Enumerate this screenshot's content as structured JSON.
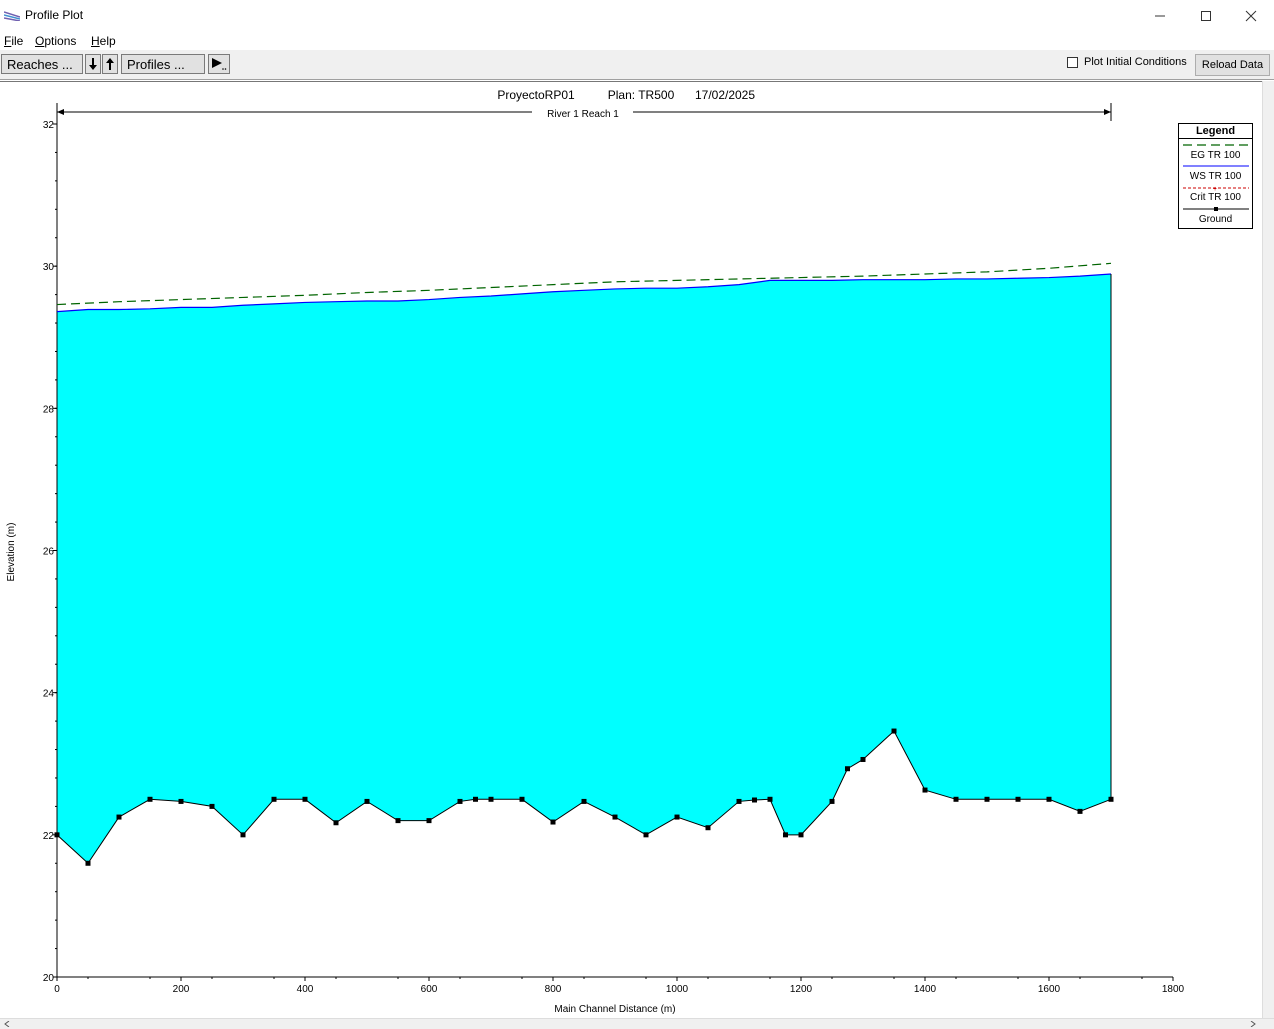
{
  "window": {
    "title": "Profile Plot",
    "minimize_glyph": "—",
    "maximize_glyph": "☐",
    "close_glyph": "✕"
  },
  "menu": {
    "file": {
      "accel": "F",
      "rest": "ile"
    },
    "options": {
      "accel": "O",
      "rest": "ptions"
    },
    "help": {
      "accel": "H",
      "rest": "elp"
    }
  },
  "toolbar": {
    "reaches_label": "Reaches ...",
    "profiles_label": "Profiles ...",
    "down_glyph": "🠗",
    "up_glyph": "🠕",
    "play_glyph": "▶",
    "plot_initial_label": "Plot Initial Conditions",
    "plot_initial_checked": false,
    "reload_label": "Reload Data"
  },
  "plot": {
    "project": "ProyectoRP01",
    "plan": "Plan: TR500",
    "date": "17/02/2025",
    "reach_label": "River 1 Reach 1",
    "legend": {
      "title": "Legend",
      "items": [
        "EG  TR 100",
        "WS  TR 100",
        "Crit  TR 100",
        "Ground"
      ]
    },
    "colors": {
      "water": "#00ffff",
      "ws_line": "#0000ff",
      "eg_line": "#006400",
      "crit_line": "#cc0000",
      "ground": "#000000"
    }
  },
  "chart_data": {
    "type": "line",
    "xlabel": "Main Channel Distance (m)",
    "ylabel": "Elevation (m)",
    "xlim": [
      0,
      1800
    ],
    "ylim": [
      20,
      32
    ],
    "xticks": [
      0,
      200,
      400,
      600,
      800,
      1000,
      1200,
      1400,
      1600,
      1800
    ],
    "yticks": [
      20,
      22,
      24,
      26,
      28,
      30,
      32
    ],
    "series": [
      {
        "name": "EG  TR 100",
        "x": [
          0,
          100,
          200,
          300,
          400,
          500,
          600,
          700,
          800,
          900,
          1000,
          1100,
          1200,
          1300,
          1400,
          1500,
          1600,
          1700
        ],
        "y": [
          29.46,
          29.5,
          29.53,
          29.56,
          29.59,
          29.63,
          29.66,
          29.7,
          29.74,
          29.78,
          29.8,
          29.82,
          29.84,
          29.86,
          29.89,
          29.92,
          29.97,
          30.04
        ]
      },
      {
        "name": "WS  TR 100",
        "x": [
          0,
          50,
          100,
          150,
          200,
          250,
          300,
          350,
          400,
          450,
          500,
          550,
          600,
          650,
          700,
          750,
          800,
          850,
          900,
          950,
          1000,
          1050,
          1100,
          1150,
          1200,
          1250,
          1300,
          1350,
          1400,
          1450,
          1500,
          1550,
          1600,
          1650,
          1700
        ],
        "y": [
          29.36,
          29.39,
          29.39,
          29.4,
          29.42,
          29.42,
          29.45,
          29.47,
          29.49,
          29.5,
          29.51,
          29.51,
          29.53,
          29.56,
          29.58,
          29.61,
          29.64,
          29.66,
          29.68,
          29.69,
          29.69,
          29.71,
          29.74,
          29.8,
          29.8,
          29.8,
          29.81,
          29.81,
          29.81,
          29.82,
          29.82,
          29.83,
          29.84,
          29.86,
          29.89
        ]
      },
      {
        "name": "Ground",
        "x": [
          0,
          50,
          100,
          150,
          200,
          250,
          300,
          350,
          400,
          450,
          500,
          550,
          600,
          650,
          675,
          700,
          750,
          800,
          850,
          900,
          950,
          1000,
          1050,
          1100,
          1125,
          1150,
          1175,
          1200,
          1250,
          1275,
          1300,
          1350,
          1400,
          1450,
          1500,
          1550,
          1600,
          1650,
          1700
        ],
        "y": [
          22.0,
          21.6,
          22.25,
          22.5,
          22.47,
          22.4,
          22.0,
          22.5,
          22.5,
          22.17,
          22.47,
          22.2,
          22.2,
          22.47,
          22.5,
          22.5,
          22.5,
          22.18,
          22.47,
          22.25,
          22.0,
          22.25,
          22.1,
          22.47,
          22.49,
          22.5,
          22.0,
          22.0,
          22.47,
          22.93,
          23.06,
          23.46,
          22.63,
          22.5,
          22.5,
          22.5,
          22.5,
          22.33,
          22.5
        ]
      }
    ]
  }
}
